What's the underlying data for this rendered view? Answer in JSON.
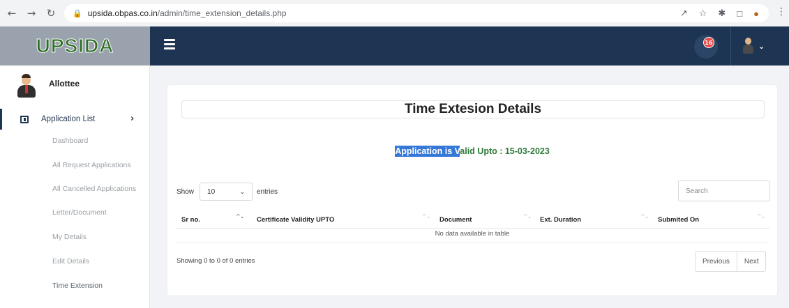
{
  "browser": {
    "url_domain": "upsida.obpas.co.in",
    "url_path": "/admin/time_extension_details.php"
  },
  "app": {
    "logo_text": "UPSIDA",
    "notification_count": "16",
    "accent_color": "#1d3553"
  },
  "sidebar": {
    "profile_name": "Allottee",
    "section_label": "Application List",
    "items": [
      {
        "label": "Dashboard"
      },
      {
        "label": "All Request Applications"
      },
      {
        "label": "All Cancelled Applications"
      },
      {
        "label": "Letter/Document"
      },
      {
        "label": "My Details"
      },
      {
        "label": "Edit Details"
      },
      {
        "label": "Time Extension"
      }
    ]
  },
  "main": {
    "title": "Time Extesion Details",
    "validity_highlight": "Application is V",
    "validity_rest": "alid Upto : 15-03-2023",
    "show_label": "Show",
    "entries_value": "10",
    "entries_label": "entries",
    "search_placeholder": "Search",
    "columns": [
      "Sr no.",
      "Certificate Validity UPTO",
      "Document",
      "Ext. Duration",
      "Submited On"
    ],
    "empty_text": "No data available in table",
    "info_text": "Showing 0 to 0 of 0 entries",
    "prev_label": "Previous",
    "next_label": "Next"
  }
}
